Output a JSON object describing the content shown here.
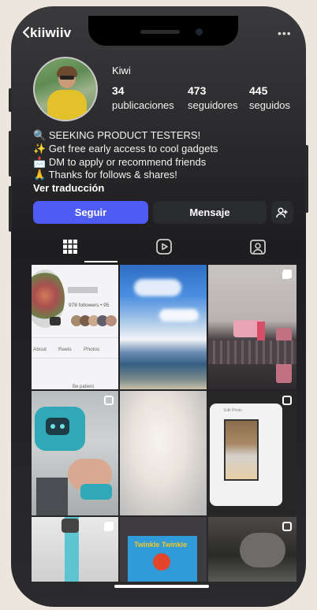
{
  "profile": {
    "username": "kiiwiiv",
    "display_name": "Kiwi",
    "stats": [
      {
        "value": "34",
        "label": "publicaciones"
      },
      {
        "value": "473",
        "label": "seguidores"
      },
      {
        "value": "445",
        "label": "seguidos"
      }
    ],
    "bio": [
      {
        "emoji": "🔍",
        "text": "SEEKING PRODUCT TESTERS!"
      },
      {
        "emoji": "✨",
        "text": "Get free early access to cool gadgets"
      },
      {
        "emoji": "📩",
        "text": "DM to apply or recommend friends"
      },
      {
        "emoji": "🙏",
        "text": "Thanks for follows & shares!"
      }
    ],
    "translate_link": "Ver traducción"
  },
  "actions": {
    "follow_label": "Seguir",
    "message_label": "Mensaje"
  },
  "tabs": [
    "grid-icon",
    "reels-icon",
    "tagged-icon"
  ],
  "grid_posts": {
    "post1": {
      "followers_text": "978 followers • 95",
      "tab_about": "About",
      "tab_reels": "Reels",
      "tab_photos": "Photos",
      "caption": "Be patient"
    },
    "post6": {
      "header": "Edit Photo"
    },
    "post8": {
      "box_text": "Twinkle Twinkle"
    }
  },
  "colors": {
    "follow_button": "#4f5cf3",
    "background": "#0b0b0c",
    "secondary_button": "#2a2b2e"
  }
}
